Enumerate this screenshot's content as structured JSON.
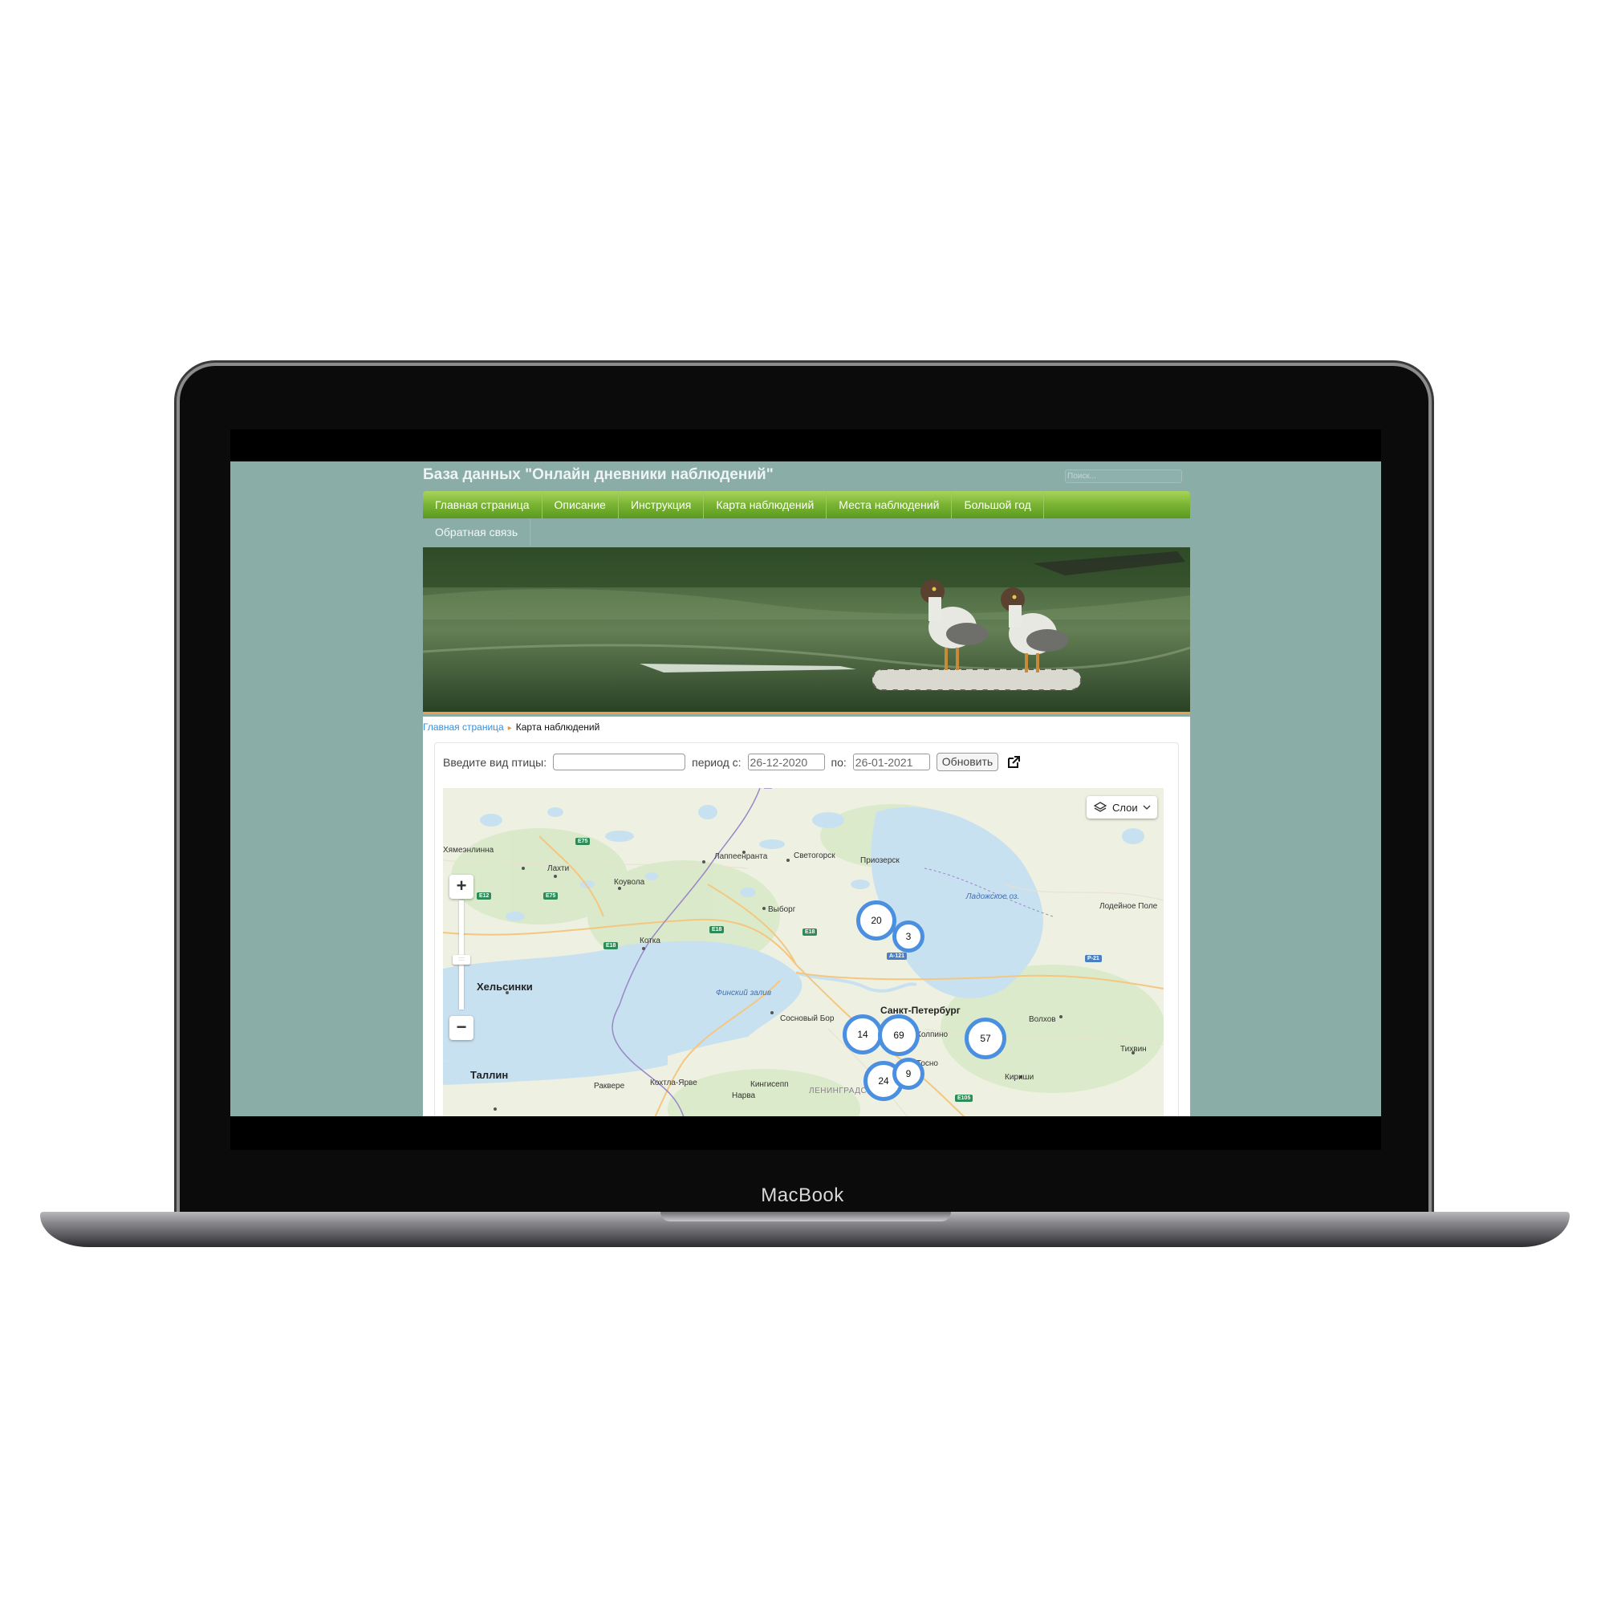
{
  "device": {
    "label": "MacBook"
  },
  "site": {
    "title": "База данных \"Онлайн дневники наблюдений\"",
    "search_placeholder": "Поиск...",
    "nav": [
      "Главная страница",
      "Описание",
      "Инструкция",
      "Карта наблюдений",
      "Места наблюдений",
      "Большой год",
      "Обратная связь"
    ],
    "breadcrumb": {
      "home": "Главная страница",
      "current": "Карта наблюдений"
    }
  },
  "filter": {
    "bird_label": "Введите вид птицы:",
    "bird_value": "",
    "period_from_label": "период с:",
    "period_from": "26-12-2020",
    "period_to_label": "по:",
    "period_to": "26-01-2021",
    "refresh_label": "Обновить"
  },
  "map": {
    "layers_label": "Слои",
    "places": {
      "hameenlinna": "Хямеэнлинна",
      "lahti": "Лахти",
      "kouvola": "Коувола",
      "lappeenranta": "Лаппеенранта",
      "svetogorsk": "Светогорск",
      "priozersk": "Приозерск",
      "ladoga": "Ладожское оз.",
      "lodeynoe": "Лодейное Поле",
      "vyborg": "Выборг",
      "kotka": "Котка",
      "helsinki": "Хельсинки",
      "gulf": "Финский залив",
      "sosnovy_bor": "Сосновый Бор",
      "spb": "Санкт-Петербург",
      "volkhov": "Волхов",
      "tikhvin": "Тихвин",
      "kirishi": "Кириши",
      "tallinn": "Таллин",
      "rakvere": "Раквере",
      "kohtla": "Кохтла-Ярве",
      "kingisepp": "Кингисепп",
      "narva": "Нарва",
      "lenobl": "ЛЕНИНГРАДСКАЯ",
      "tosno": "Тосно",
      "kolpino": "Колпино"
    },
    "roads": [
      "E75",
      "E75",
      "E12",
      "E18",
      "E18",
      "E18",
      "A-121",
      "P-21",
      "E105"
    ],
    "clusters": [
      20,
      3,
      14,
      69,
      57,
      24,
      9
    ]
  },
  "colors": {
    "page_bg": "#8aada8",
    "nav_green": "#7db636",
    "cluster_ring": "#4a8fe0",
    "link": "#3b8ed8",
    "breadcrumb_sep": "#e69540"
  }
}
